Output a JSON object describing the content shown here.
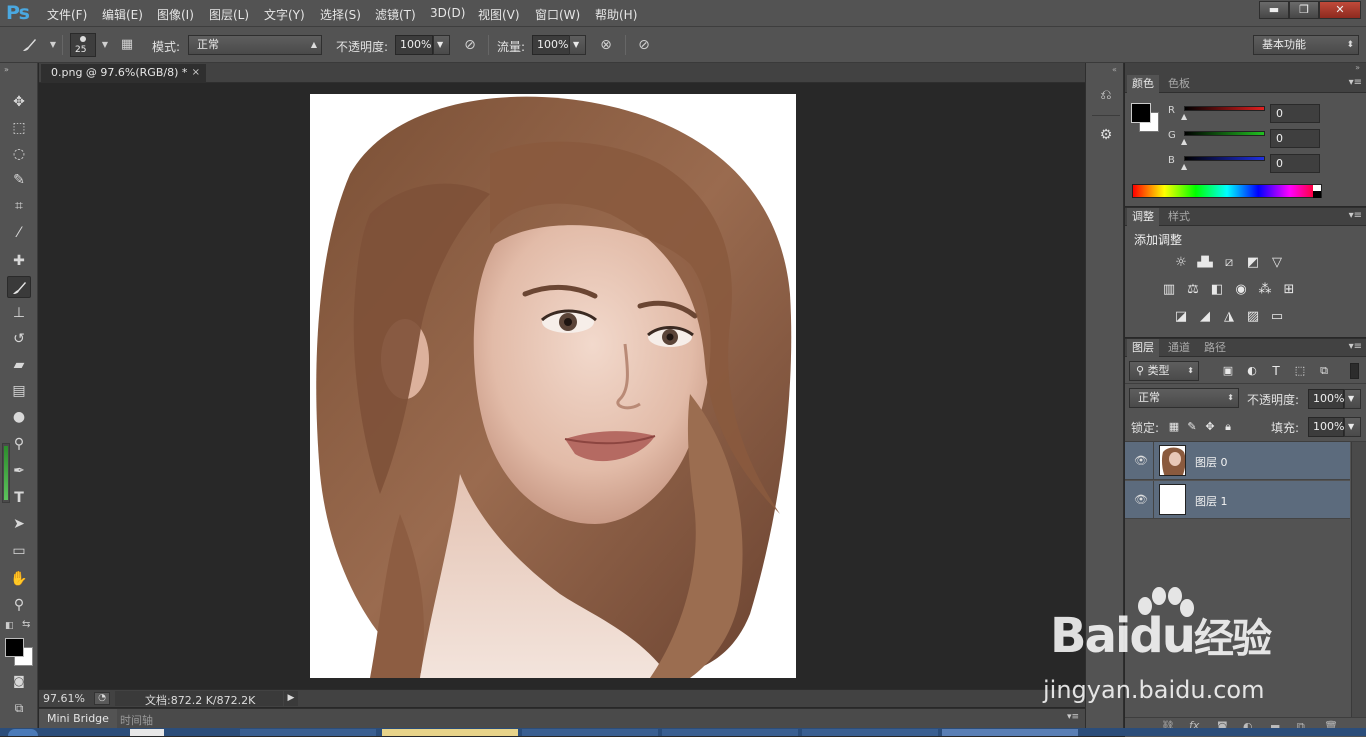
{
  "app": {
    "logo": "Ps"
  },
  "menu": [
    "文件(F)",
    "编辑(E)",
    "图像(I)",
    "图层(L)",
    "文字(Y)",
    "选择(S)",
    "滤镜(T)",
    "3D(D)",
    "视图(V)",
    "窗口(W)",
    "帮助(H)"
  ],
  "window_buttons": {
    "minimize": "▬",
    "restore": "❐",
    "close": "✕"
  },
  "options": {
    "brush_size": "25",
    "mode_label": "模式:",
    "mode_value": "正常",
    "opacity_label": "不透明度:",
    "opacity_value": "100%",
    "flow_label": "流量:",
    "flow_value": "100%",
    "workspace": "基本功能"
  },
  "document": {
    "tab_title": "0.png @ 97.6%(RGB/8) *",
    "tab_close": "×",
    "zoom": "97.61%",
    "doc_info": "文档:872.2 K/872.2K"
  },
  "bottom_tabs": {
    "mini_bridge": "Mini Bridge",
    "timeline": "时间轴"
  },
  "color_panel": {
    "tabs": [
      "颜色",
      "色板"
    ],
    "channels": [
      {
        "label": "R",
        "value": "0",
        "color": "#e02020"
      },
      {
        "label": "G",
        "value": "0",
        "color": "#20c020"
      },
      {
        "label": "B",
        "value": "0",
        "color": "#2030e0"
      }
    ]
  },
  "adjust_panel": {
    "tabs": [
      "调整",
      "样式"
    ],
    "title": "添加调整"
  },
  "layers_panel": {
    "tabs": [
      "图层",
      "通道",
      "路径"
    ],
    "filter_kind": "类型",
    "blend_mode": "正常",
    "opacity_label": "不透明度:",
    "opacity_value": "100%",
    "lock_label": "锁定:",
    "fill_label": "填充:",
    "fill_value": "100%",
    "layers": [
      {
        "name": "图层 0",
        "thumb": "photo"
      },
      {
        "name": "图层 1",
        "thumb": "white"
      }
    ]
  },
  "watermark": {
    "brand": "Baidu",
    "cn": "经验",
    "url": "jingyan.baidu.com"
  },
  "colors": {
    "ui_bg": "#535353",
    "canvas_bg": "#282828",
    "selection": "#5c6b7d"
  }
}
